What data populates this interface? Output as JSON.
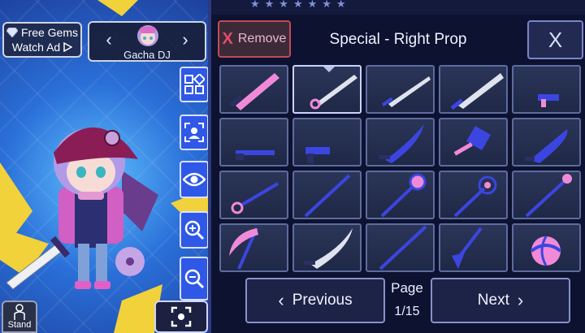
{
  "top_left": {
    "free_gems_label": "Free Gems",
    "watch_ad_label": "Watch Ad",
    "gem_icon": "diamond-icon",
    "play_icon": "play-triangle-icon"
  },
  "character_selector": {
    "name": "Gacha DJ",
    "prev_icon": "chevron-left-icon",
    "next_icon": "chevron-right-icon"
  },
  "side_tools": [
    {
      "name": "grid-layout-icon"
    },
    {
      "name": "camera-capture-icon"
    },
    {
      "name": "eye-icon"
    },
    {
      "name": "zoom-in-icon"
    },
    {
      "name": "zoom-out-icon"
    },
    {
      "name": "focus-frame-icon"
    }
  ],
  "stand_label": "Stand",
  "panel": {
    "remove_label": "Remove",
    "title": "Special - Right Prop",
    "close_label": "X"
  },
  "items": [
    {
      "name": "pink-sword"
    },
    {
      "name": "steel-sword"
    },
    {
      "name": "long-sword"
    },
    {
      "name": "broad-sword"
    },
    {
      "name": "small-gun"
    },
    {
      "name": "shotgun"
    },
    {
      "name": "pistol"
    },
    {
      "name": "curved-blade"
    },
    {
      "name": "cleaver"
    },
    {
      "name": "knife"
    },
    {
      "name": "short-staff"
    },
    {
      "name": "spear"
    },
    {
      "name": "orb-staff"
    },
    {
      "name": "ring-staff"
    },
    {
      "name": "magic-wand"
    },
    {
      "name": "scythe"
    },
    {
      "name": "scimitar"
    },
    {
      "name": "pole"
    },
    {
      "name": "shovel"
    },
    {
      "name": "beach-ball"
    }
  ],
  "selected_index": 1,
  "pagination": {
    "prev_label": "Previous",
    "next_label": "Next",
    "page_label": "Page",
    "page_value": "1/15"
  },
  "colors": {
    "accent_blue": "#2f58e6",
    "panel_bg": "#0d1230",
    "prop_blue": "#3b46e0",
    "prop_pink": "#f08ad8"
  }
}
